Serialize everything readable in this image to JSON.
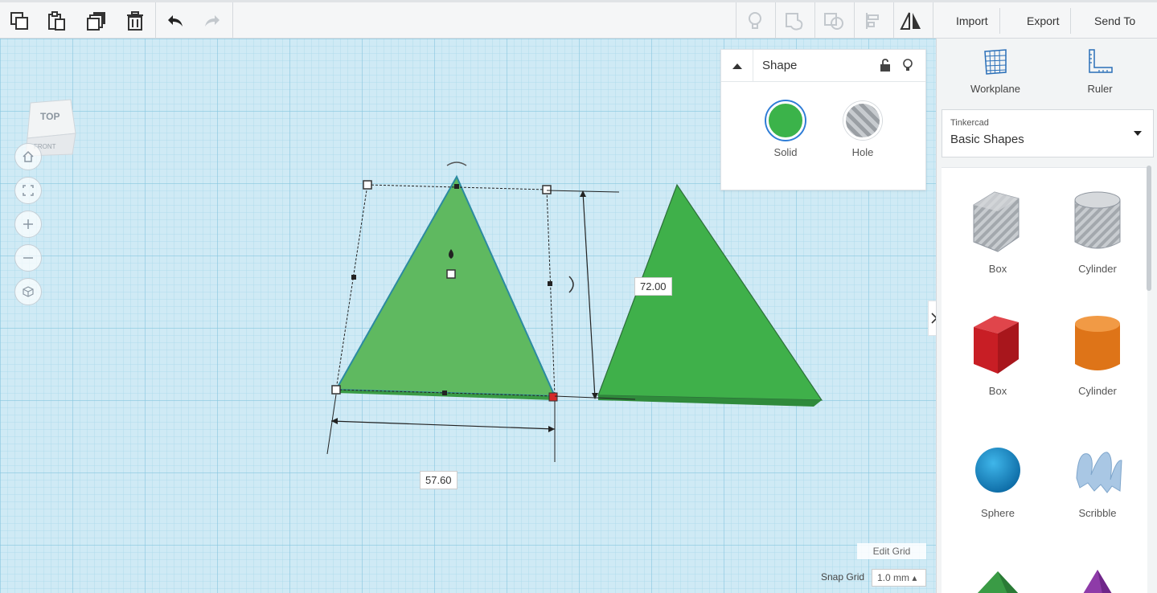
{
  "toolbar": {
    "left_icons": [
      "copy-icon",
      "paste-icon",
      "duplicate-icon",
      "trash-icon",
      "undo-icon",
      "redo-icon"
    ],
    "right_icons": [
      "lightbulb-icon",
      "group-icon",
      "ungroup-icon",
      "align-icon",
      "mirror-icon"
    ],
    "import_label": "Import",
    "export_label": "Export",
    "send_label": "Send To"
  },
  "viewcube": {
    "top_label": "TOP",
    "front_label": "FRONT"
  },
  "shape_panel": {
    "title": "Shape",
    "solid_label": "Solid",
    "hole_label": "Hole",
    "solid_color": "#3bb34a"
  },
  "workplane": {
    "width_value": "57.60",
    "height_value": "72.00",
    "edit_grid_label": "Edit Grid",
    "snap_grid_label": "Snap Grid",
    "snap_grid_value": "1.0 mm ▴"
  },
  "sidebar": {
    "workplane_label": "Workplane",
    "ruler_label": "Ruler",
    "library_small": "Tinkercad",
    "library_main": "Basic Shapes",
    "shapes": [
      {
        "label": "Box"
      },
      {
        "label": "Cylinder"
      },
      {
        "label": "Box"
      },
      {
        "label": "Cylinder"
      },
      {
        "label": "Sphere"
      },
      {
        "label": "Scribble"
      }
    ]
  },
  "colors": {
    "grid_bg": "#cfeaf5",
    "grid_line": "#a7d7ea",
    "shape_green": "#3bb34a",
    "selected_green": "#57b75f"
  }
}
